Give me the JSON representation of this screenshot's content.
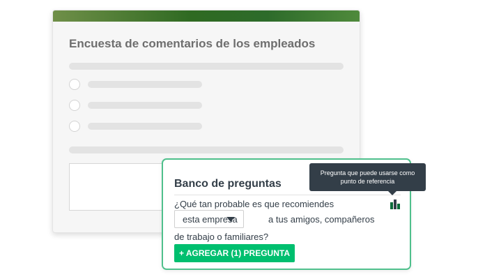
{
  "survey": {
    "title": "Encuesta de comentarios de los empleados"
  },
  "question_bank": {
    "title": "Banco de preguntas",
    "question_prefix": "¿Qué tan probable es que recomiendes",
    "select_value": "esta empresa",
    "question_middle": "a tus amigos, compañeros",
    "question_suffix": "de trabajo o familiares?",
    "add_button_label": "+ AGREGAR (1) PREGUNTA",
    "benchmark_icon": "benchmark-icon"
  },
  "tooltip": {
    "line1": "Pregunta que puede usarse como",
    "line2": "punto de referencia"
  },
  "colors": {
    "accent_green": "#00bf6f",
    "card_border": "#4fc08c",
    "header_green": "#2f6a22",
    "tooltip_bg": "#333e48"
  }
}
